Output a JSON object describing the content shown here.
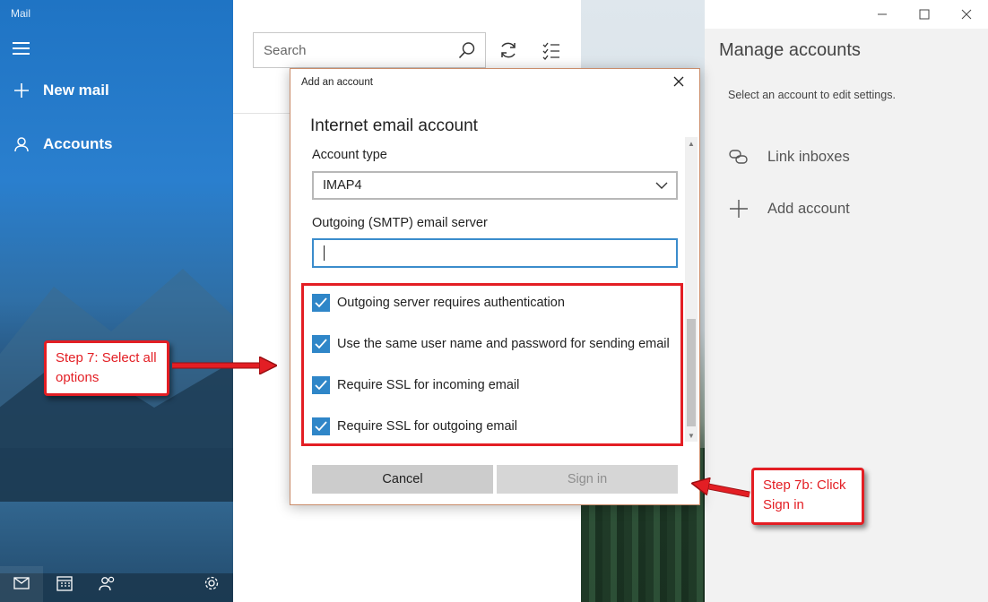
{
  "app": {
    "title": "Mail"
  },
  "nav": {
    "new_mail": "New mail",
    "accounts": "Accounts",
    "icons": {
      "menu": "hamburger-icon",
      "new_mail": "plus-icon",
      "accounts": "person-icon",
      "mail": "mail-icon",
      "calendar": "calendar-icon",
      "people": "people-icon",
      "settings": "gear-icon"
    }
  },
  "list": {
    "search_placeholder": "Search"
  },
  "manage": {
    "title": "Manage accounts",
    "subtitle": "Select an account to edit settings.",
    "link_inboxes": "Link inboxes",
    "add_account": "Add account"
  },
  "dialog": {
    "caption": "Add an account",
    "heading": "Internet email account",
    "account_type_label": "Account type",
    "account_type_value": "IMAP4",
    "smtp_label": "Outgoing (SMTP) email server",
    "smtp_value": "",
    "options": [
      {
        "label": "Outgoing server requires authentication",
        "checked": true
      },
      {
        "label": "Use the same user name and password for sending email",
        "checked": true
      },
      {
        "label": "Require SSL for incoming email",
        "checked": true
      },
      {
        "label": "Require SSL for outgoing email",
        "checked": true
      }
    ],
    "cancel": "Cancel",
    "sign_in": "Sign in"
  },
  "annotations": {
    "step7": "Step 7: Select all options",
    "step7b": "Step 7b: Click Sign in",
    "color": "#e31e24"
  },
  "colors": {
    "accent": "#2f86c8",
    "nav_blue": "#1f74c4"
  }
}
